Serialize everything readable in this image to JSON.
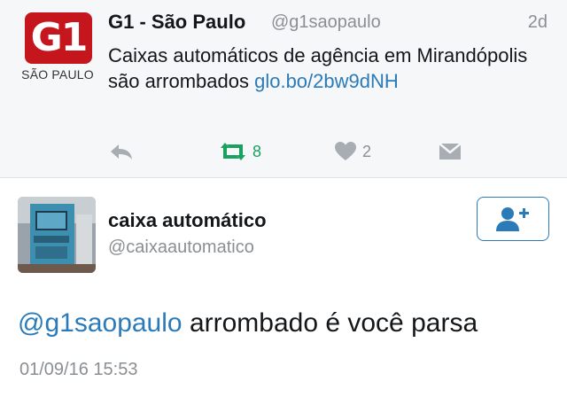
{
  "tweet1": {
    "avatar": {
      "logo_text": "G1",
      "subtitle": "SÃO PAULO",
      "brand_color": "#c4161c"
    },
    "name": "G1 - São Paulo",
    "handle": "@g1saopaulo",
    "time": "2d",
    "text": "Caixas automáticos de agência em Mirandópolis são arrombados ",
    "link": "glo.bo/2bw9dNH",
    "actions": {
      "reply_icon": "reply-icon",
      "retweet_icon": "retweet-icon",
      "retweet_count": "8",
      "like_icon": "heart-icon",
      "like_count": "2",
      "dm_icon": "envelope-icon"
    }
  },
  "tweet2": {
    "avatar": {
      "icon": "atm-machine-photo"
    },
    "name": "caixa automático",
    "handle": "@caixaautomatico",
    "follow_icon": "add-user-icon",
    "mention": "@g1saopaulo",
    "text": " arrombado é você parsa",
    "timestamp": "01/09/16 15:53"
  },
  "colors": {
    "link": "#2b7bb9",
    "retweet": "#19a15f",
    "muted": "#8a8f94",
    "top_background": "#f6f7f9"
  }
}
